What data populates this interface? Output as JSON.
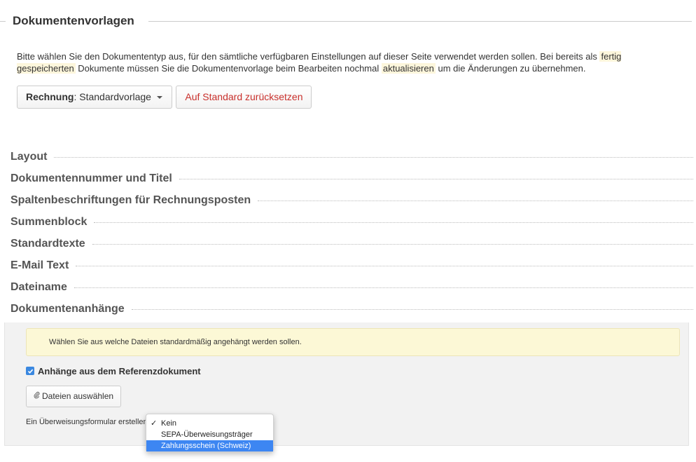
{
  "header": {
    "title": "Dokumentenvorlagen"
  },
  "intro": {
    "part1": "Bitte wählen Sie den Dokumententyp aus, für den sämtliche verfügbaren Einstellungen auf dieser Seite verwendet werden sollen. Bei bereits als ",
    "hl1": "fertig gespeicherten",
    "part2": " Dokumente müssen Sie die Dokumentenvorlage beim Bearbeiten nochmal ",
    "hl2": "aktualisieren",
    "part3": " um die Änderungen zu übernehmen."
  },
  "template_select": {
    "type_label": "Rechnung",
    "separator": ":",
    "value": " Standardvorlage"
  },
  "reset_button": {
    "label": "Auf Standard zurücksetzen"
  },
  "sections": [
    {
      "label": "Layout"
    },
    {
      "label": "Dokumentennummer und Titel"
    },
    {
      "label": "Spaltenbeschriftungen für Rechnungsposten"
    },
    {
      "label": "Summenblock"
    },
    {
      "label": "Standardtexte"
    },
    {
      "label": "E-Mail Text"
    },
    {
      "label": "Dateiname"
    },
    {
      "label": "Dokumentenanhänge"
    }
  ],
  "attachments": {
    "info": "Wählen Sie aus welche Dateien standardmäßig angehängt werden sollen.",
    "checkbox_label": "Anhänge aus dem Referenzdokument",
    "checkbox_checked": true,
    "select_files_label": "Dateien auswählen",
    "transfer_form_label": "Ein Überweisungsformular erstellen"
  },
  "transfer_menu": {
    "options": [
      {
        "label": "Kein",
        "checked": true
      },
      {
        "label": "SEPA-Überweisungsträger",
        "checked": false
      },
      {
        "label": "Zahlungsschein (Schweiz)",
        "highlighted": true
      }
    ]
  },
  "colors": {
    "accent": "#3d86f2",
    "danger": "#c9302c",
    "highlight": "#fdf6dc",
    "alert_bg": "#fcf8d6"
  }
}
